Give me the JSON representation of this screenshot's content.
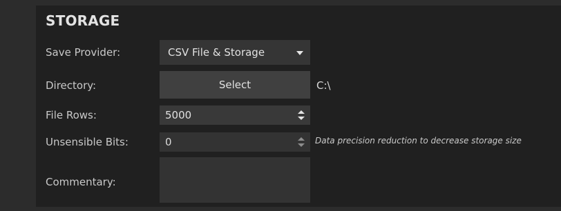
{
  "section": {
    "title": "STORAGE"
  },
  "fields": {
    "save_provider": {
      "label": "Save Provider:",
      "value": "CSV File & Storage",
      "icon": "chevron-down-icon"
    },
    "directory": {
      "label": "Directory:",
      "button_label": "Select",
      "path": "C:\\"
    },
    "file_rows": {
      "label": "File Rows:",
      "value": "5000"
    },
    "unsensible_bits": {
      "label": "Unsensible Bits:",
      "value": "0",
      "hint": "Data precision reduction to decrease storage size"
    },
    "commentary": {
      "label": "Commentary:",
      "value": ""
    }
  }
}
